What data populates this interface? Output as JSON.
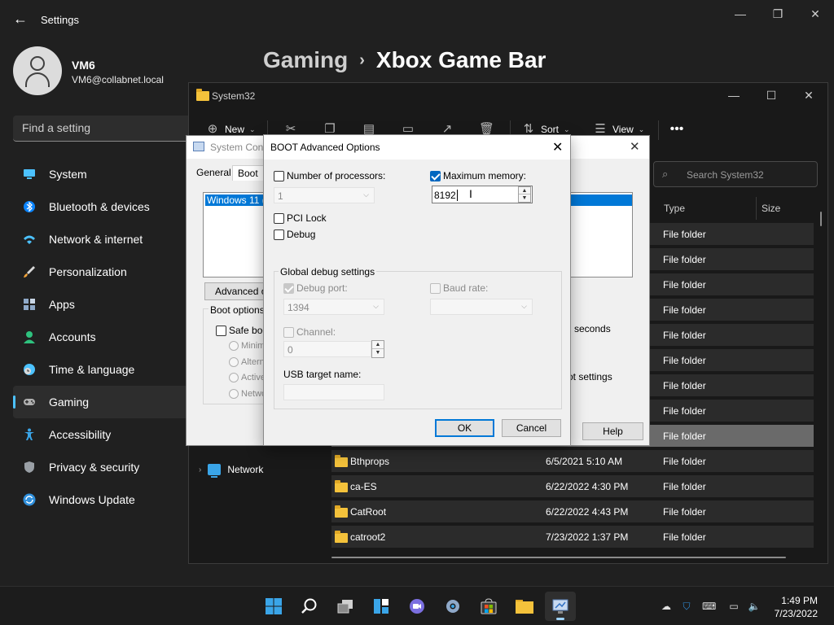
{
  "settings": {
    "title": "Settings",
    "user": {
      "name": "VM6",
      "email": "VM6@collabnet.local"
    },
    "search_placeholder": "Find a setting",
    "nav": [
      {
        "label": "System",
        "icon": "monitor-icon",
        "color": "#4cc2ff"
      },
      {
        "label": "Bluetooth & devices",
        "icon": "bluetooth-icon",
        "color": "#0a84ff"
      },
      {
        "label": "Network & internet",
        "icon": "wifi-icon",
        "color": "#4cc2ff"
      },
      {
        "label": "Personalization",
        "icon": "brush-icon",
        "color": "#f2a33a"
      },
      {
        "label": "Apps",
        "icon": "apps-icon",
        "color": "#8fa9c9"
      },
      {
        "label": "Accounts",
        "icon": "person-icon",
        "color": "#2ec27e"
      },
      {
        "label": "Time & language",
        "icon": "clock-globe-icon",
        "color": "#4cc2ff"
      },
      {
        "label": "Gaming",
        "icon": "gamepad-icon",
        "color": "#b0b0b0"
      },
      {
        "label": "Accessibility",
        "icon": "accessibility-icon",
        "color": "#3aa5e8"
      },
      {
        "label": "Privacy & security",
        "icon": "shield-icon",
        "color": "#9aa0a6"
      },
      {
        "label": "Windows Update",
        "icon": "update-icon",
        "color": "#2f8fdc"
      }
    ],
    "active_nav": "Gaming",
    "breadcrumb": {
      "parent": "Gaming",
      "separator": "›",
      "current": "Xbox Game Bar"
    }
  },
  "explorer": {
    "title": "System32",
    "toolbar": {
      "new_label": "New",
      "sort_label": "Sort",
      "view_label": "View"
    },
    "search_placeholder": "Search System32",
    "columns": {
      "type": "Type",
      "size": "Size"
    },
    "sidebar_item": "Network",
    "rows": [
      {
        "name": "",
        "date": "",
        "type": "File folder"
      },
      {
        "name": "",
        "date": "",
        "type": "File folder"
      },
      {
        "name": "",
        "date": "",
        "type": "File folder"
      },
      {
        "name": "",
        "date": "",
        "type": "File folder"
      },
      {
        "name": "",
        "date": "",
        "type": "File folder"
      },
      {
        "name": "",
        "date": "",
        "type": "File folder"
      },
      {
        "name": "",
        "date": "",
        "type": "File folder"
      },
      {
        "name": "",
        "date": "",
        "type": "File folder"
      },
      {
        "name": "",
        "date": "",
        "type": "File folder"
      },
      {
        "name": "Bthprops",
        "date": "6/5/2021 5:10 AM",
        "type": "File folder"
      },
      {
        "name": "ca-ES",
        "date": "6/22/2022 4:30 PM",
        "type": "File folder"
      },
      {
        "name": "CatRoot",
        "date": "6/22/2022 4:43 PM",
        "type": "File folder"
      },
      {
        "name": "catroot2",
        "date": "7/23/2022 1:37 PM",
        "type": "File folder"
      }
    ]
  },
  "sysconfig": {
    "title": "System Conf",
    "tabs": [
      "General",
      "Boot"
    ],
    "os_entry": "Windows 11 (C",
    "advanced_button": "Advanced op",
    "boot_options_label": "Boot options",
    "safe_boot_label": "Safe boo",
    "radios": [
      "Minima",
      "Altern",
      "Active",
      "Netwo"
    ],
    "seconds_label": "seconds",
    "boot_settings_label": "ot settings",
    "help_button": "Help"
  },
  "boot_advanced": {
    "title": "BOOT Advanced Options",
    "processors_label": "Number of processors:",
    "processors_checked": false,
    "processors_value": "1",
    "max_memory_label": "Maximum memory:",
    "max_memory_checked": true,
    "max_memory_value": "8192",
    "pci_lock_label": "PCI Lock",
    "debug_label": "Debug",
    "global_debug_label": "Global debug settings",
    "debug_port_label": "Debug port:",
    "debug_port_value": "1394",
    "baud_rate_label": "Baud rate:",
    "channel_label": "Channel:",
    "channel_value": "0",
    "usb_target_label": "USB target name:",
    "ok_label": "OK",
    "cancel_label": "Cancel"
  },
  "taskbar": {
    "apps": [
      "start-icon",
      "search-icon",
      "task-view-icon",
      "widgets-icon",
      "chat-icon",
      "settings-icon",
      "store-icon",
      "file-explorer-icon",
      "msconfig-icon"
    ],
    "time": "1:49 PM",
    "date": "7/23/2022"
  }
}
